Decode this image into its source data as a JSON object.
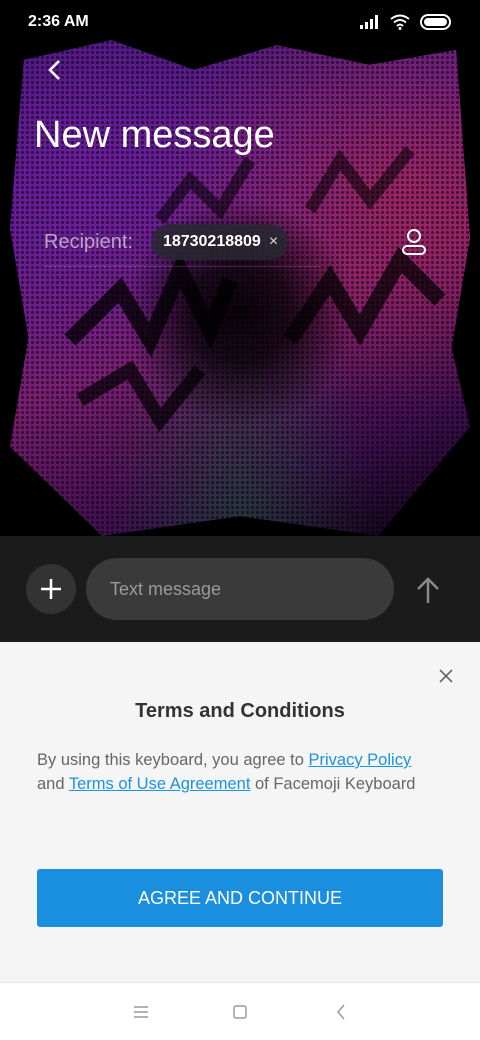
{
  "status_bar": {
    "time": "2:36 AM"
  },
  "header": {
    "title": "New message"
  },
  "recipient": {
    "label": "Recipient:",
    "chip_value": "18730218809",
    "chip_remove_glyph": "×"
  },
  "composer": {
    "placeholder": "Text message"
  },
  "terms": {
    "title": "Terms and Conditions",
    "body_prefix": "By using this keyboard, you agree to ",
    "privacy_link": "Privacy Policy",
    "body_middle": " and ",
    "terms_link": "Terms of Use Agreement",
    "body_suffix": " of Facemoji Keyboard",
    "agree_button": "AGREE AND CONTINUE"
  },
  "icons": {
    "back": "chevron-left-icon",
    "contact": "person-icon",
    "add": "plus-icon",
    "send": "arrow-up-icon",
    "close": "close-icon",
    "nav_menu": "menu-icon",
    "nav_home": "square-icon",
    "nav_back": "chevron-left-icon"
  },
  "colors": {
    "accent": "#1a8fe0",
    "link": "#1a94e0",
    "composer_bg": "#1b1b1b",
    "sheet_bg": "#f5f5f5"
  }
}
